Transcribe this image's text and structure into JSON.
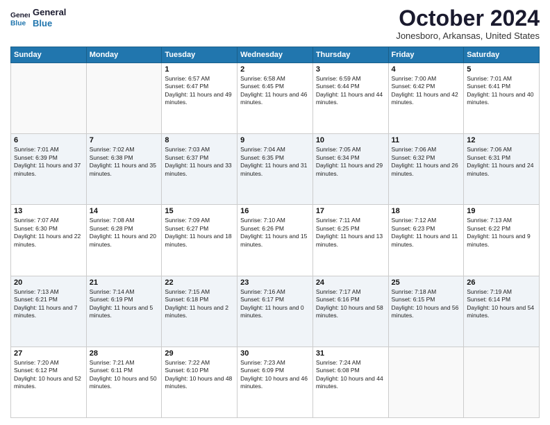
{
  "header": {
    "logo_line1": "General",
    "logo_line2": "Blue",
    "month": "October 2024",
    "location": "Jonesboro, Arkansas, United States"
  },
  "days_of_week": [
    "Sunday",
    "Monday",
    "Tuesday",
    "Wednesday",
    "Thursday",
    "Friday",
    "Saturday"
  ],
  "weeks": [
    [
      {
        "day": "",
        "detail": ""
      },
      {
        "day": "",
        "detail": ""
      },
      {
        "day": "1",
        "detail": "Sunrise: 6:57 AM\nSunset: 6:47 PM\nDaylight: 11 hours and 49 minutes."
      },
      {
        "day": "2",
        "detail": "Sunrise: 6:58 AM\nSunset: 6:45 PM\nDaylight: 11 hours and 46 minutes."
      },
      {
        "day": "3",
        "detail": "Sunrise: 6:59 AM\nSunset: 6:44 PM\nDaylight: 11 hours and 44 minutes."
      },
      {
        "day": "4",
        "detail": "Sunrise: 7:00 AM\nSunset: 6:42 PM\nDaylight: 11 hours and 42 minutes."
      },
      {
        "day": "5",
        "detail": "Sunrise: 7:01 AM\nSunset: 6:41 PM\nDaylight: 11 hours and 40 minutes."
      }
    ],
    [
      {
        "day": "6",
        "detail": "Sunrise: 7:01 AM\nSunset: 6:39 PM\nDaylight: 11 hours and 37 minutes."
      },
      {
        "day": "7",
        "detail": "Sunrise: 7:02 AM\nSunset: 6:38 PM\nDaylight: 11 hours and 35 minutes."
      },
      {
        "day": "8",
        "detail": "Sunrise: 7:03 AM\nSunset: 6:37 PM\nDaylight: 11 hours and 33 minutes."
      },
      {
        "day": "9",
        "detail": "Sunrise: 7:04 AM\nSunset: 6:35 PM\nDaylight: 11 hours and 31 minutes."
      },
      {
        "day": "10",
        "detail": "Sunrise: 7:05 AM\nSunset: 6:34 PM\nDaylight: 11 hours and 29 minutes."
      },
      {
        "day": "11",
        "detail": "Sunrise: 7:06 AM\nSunset: 6:32 PM\nDaylight: 11 hours and 26 minutes."
      },
      {
        "day": "12",
        "detail": "Sunrise: 7:06 AM\nSunset: 6:31 PM\nDaylight: 11 hours and 24 minutes."
      }
    ],
    [
      {
        "day": "13",
        "detail": "Sunrise: 7:07 AM\nSunset: 6:30 PM\nDaylight: 11 hours and 22 minutes."
      },
      {
        "day": "14",
        "detail": "Sunrise: 7:08 AM\nSunset: 6:28 PM\nDaylight: 11 hours and 20 minutes."
      },
      {
        "day": "15",
        "detail": "Sunrise: 7:09 AM\nSunset: 6:27 PM\nDaylight: 11 hours and 18 minutes."
      },
      {
        "day": "16",
        "detail": "Sunrise: 7:10 AM\nSunset: 6:26 PM\nDaylight: 11 hours and 15 minutes."
      },
      {
        "day": "17",
        "detail": "Sunrise: 7:11 AM\nSunset: 6:25 PM\nDaylight: 11 hours and 13 minutes."
      },
      {
        "day": "18",
        "detail": "Sunrise: 7:12 AM\nSunset: 6:23 PM\nDaylight: 11 hours and 11 minutes."
      },
      {
        "day": "19",
        "detail": "Sunrise: 7:13 AM\nSunset: 6:22 PM\nDaylight: 11 hours and 9 minutes."
      }
    ],
    [
      {
        "day": "20",
        "detail": "Sunrise: 7:13 AM\nSunset: 6:21 PM\nDaylight: 11 hours and 7 minutes."
      },
      {
        "day": "21",
        "detail": "Sunrise: 7:14 AM\nSunset: 6:19 PM\nDaylight: 11 hours and 5 minutes."
      },
      {
        "day": "22",
        "detail": "Sunrise: 7:15 AM\nSunset: 6:18 PM\nDaylight: 11 hours and 2 minutes."
      },
      {
        "day": "23",
        "detail": "Sunrise: 7:16 AM\nSunset: 6:17 PM\nDaylight: 11 hours and 0 minutes."
      },
      {
        "day": "24",
        "detail": "Sunrise: 7:17 AM\nSunset: 6:16 PM\nDaylight: 10 hours and 58 minutes."
      },
      {
        "day": "25",
        "detail": "Sunrise: 7:18 AM\nSunset: 6:15 PM\nDaylight: 10 hours and 56 minutes."
      },
      {
        "day": "26",
        "detail": "Sunrise: 7:19 AM\nSunset: 6:14 PM\nDaylight: 10 hours and 54 minutes."
      }
    ],
    [
      {
        "day": "27",
        "detail": "Sunrise: 7:20 AM\nSunset: 6:12 PM\nDaylight: 10 hours and 52 minutes."
      },
      {
        "day": "28",
        "detail": "Sunrise: 7:21 AM\nSunset: 6:11 PM\nDaylight: 10 hours and 50 minutes."
      },
      {
        "day": "29",
        "detail": "Sunrise: 7:22 AM\nSunset: 6:10 PM\nDaylight: 10 hours and 48 minutes."
      },
      {
        "day": "30",
        "detail": "Sunrise: 7:23 AM\nSunset: 6:09 PM\nDaylight: 10 hours and 46 minutes."
      },
      {
        "day": "31",
        "detail": "Sunrise: 7:24 AM\nSunset: 6:08 PM\nDaylight: 10 hours and 44 minutes."
      },
      {
        "day": "",
        "detail": ""
      },
      {
        "day": "",
        "detail": ""
      }
    ]
  ]
}
